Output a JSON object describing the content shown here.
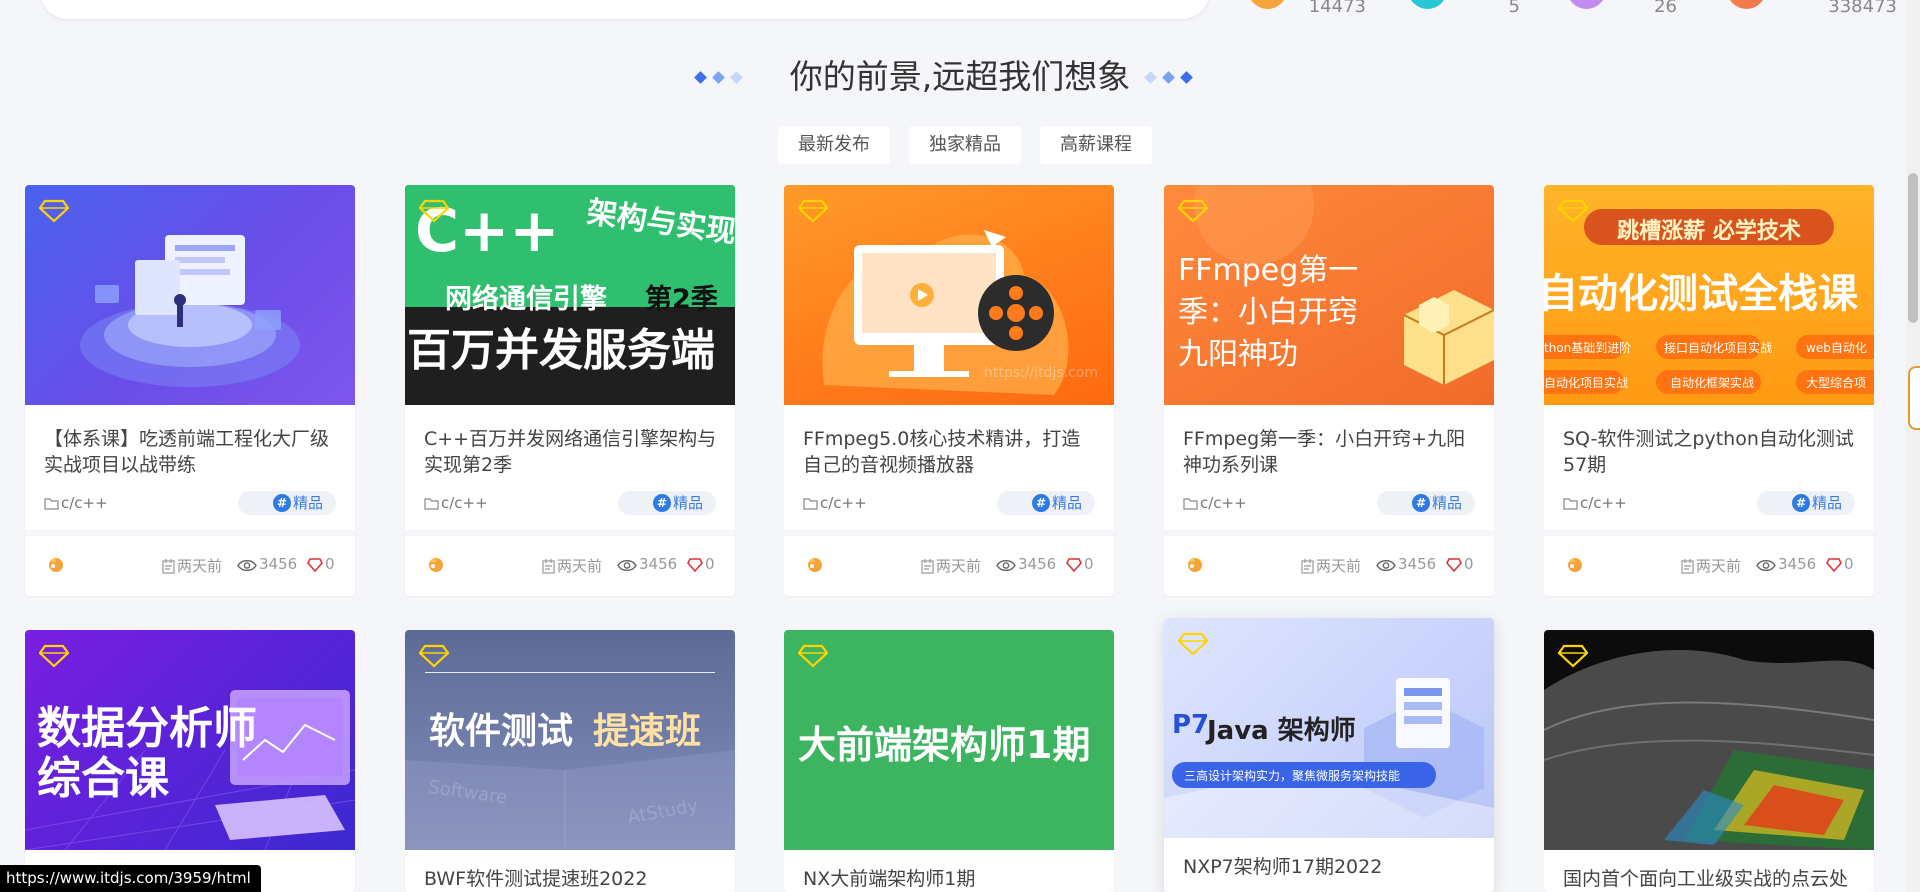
{
  "stats": [
    "14473",
    "5",
    "26",
    "338473"
  ],
  "stat_colors": [
    "#f7a53a",
    "#28c7d6",
    "#c28bf0",
    "#f47a4a"
  ],
  "heading": "你的前景,远超我们想象",
  "tabs": [
    "最新发布",
    "独家精品",
    "高薪课程"
  ],
  "cards": [
    {
      "cover_text": "",
      "title": "【体系课】吃透前端工程化大厂级实战项目以战带练",
      "category": "c/c++",
      "badge": "精品",
      "time": "两天前",
      "views": "3456",
      "likes": "0"
    },
    {
      "cover_text": "C++ 架构与实现 网络通信引擎 第2季 百万并发服务端",
      "title": "C++百万并发网络通信引擎架构与实现第2季",
      "category": "c/c++",
      "badge": "精品",
      "time": "两天前",
      "views": "3456",
      "likes": "0"
    },
    {
      "cover_text": "https://itdjs.com",
      "title": "FFmpeg5.0核心技术精讲，打造自己的音视频播放器",
      "category": "c/c++",
      "badge": "精品",
      "time": "两天前",
      "views": "3456",
      "likes": "0"
    },
    {
      "cover_text": "FFmpeg第一季：小白开窍九阳神功",
      "title": "FFmpeg第一季：小白开窍+九阳神功系列课",
      "category": "c/c++",
      "badge": "精品",
      "time": "两天前",
      "views": "3456",
      "likes": "0"
    },
    {
      "cover_text": "跳槽涨薪 必学技术 自动化测试全栈课",
      "title": "SQ-软件测试之python自动化测试57期",
      "category": "c/c++",
      "badge": "精品",
      "time": "两天前",
      "views": "3456",
      "likes": "0"
    },
    {
      "cover_text": "数据分析师综合课",
      "title": ""
    },
    {
      "cover_text": "软件测试 提速班",
      "title": "BWF软件测试提速班2022"
    },
    {
      "cover_text": "大前端架构师1期",
      "title": "NX大前端架构师1期"
    },
    {
      "cover_text": "P7Java 架构师 三高设计架构实力，聚焦微服务架构技能",
      "title": "NXP7架构师17期2022"
    },
    {
      "cover_text": "",
      "title": "国内首个面向工业级实战的点云处"
    }
  ],
  "cover2": {
    "a": "C++",
    "b": "架构与实现",
    "c": "网络通信引擎",
    "d": "第2季",
    "e": "百万并发服务端"
  },
  "cover4": {
    "l1": "FFmpeg第一",
    "l2": "季：小白开窍",
    "l3": "九阳神功"
  },
  "cover5": {
    "top": "跳槽涨薪 必学技术",
    "main": "自动化测试全栈课",
    "p1": "thon基础到进阶",
    "p2": "接口自动化项目实战",
    "p3": "web自动化",
    "p4": "自动化项目实战",
    "p5": "自动化框架实战",
    "p6": "大型综合项"
  },
  "cover3_watermark": "https://itdjs.com",
  "cover6": {
    "l1": "数据分析师",
    "l2": "综合课"
  },
  "cover7": {
    "main": "软件测试",
    "accent": "提速班",
    "w1": "Software",
    "w2": "AtStudy"
  },
  "cover8": {
    "main": "大前端架构师1期"
  },
  "cover9": {
    "p7": "P7",
    "rest": "Java 架构师",
    "pill": "三高设计架构实力，聚焦微服务架构技能"
  },
  "status_url": "https://www.itdjs.com/3959/html"
}
